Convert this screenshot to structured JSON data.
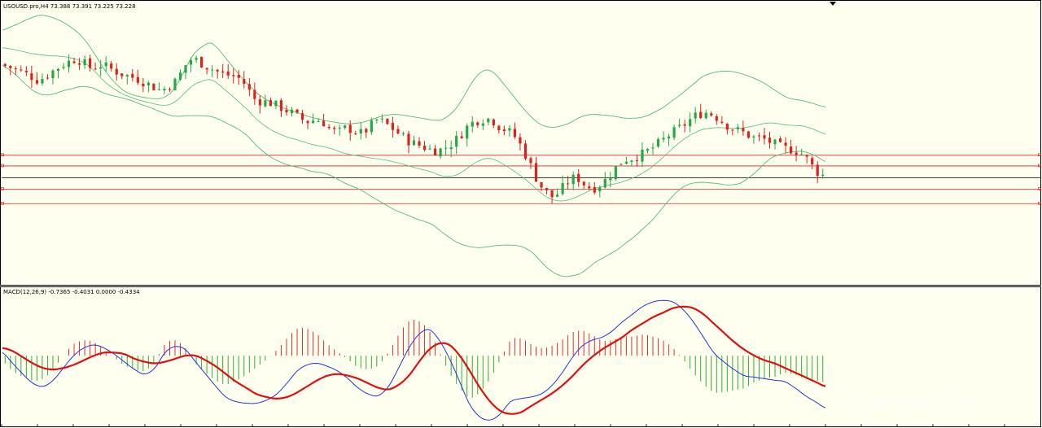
{
  "header": {
    "title": "USOUSD.pro,H4 73.388 73.391 73.225 73.228"
  },
  "indicator": {
    "title": "MACD(12,26,9) -0.7365 -0.4031 0.0000 -0.4334"
  },
  "watermark": "@WeTrade众汇 官方",
  "colors": {
    "background": "#fffff0",
    "bull": "#22aa44",
    "bear": "#e0201a",
    "bands": "#55bb77",
    "level": "#e02020",
    "macd_line": "#2233dd",
    "signal_line": "#e01010",
    "hist_pos": "#e03030",
    "hist_neg": "#33aa33"
  },
  "chart_data": [
    {
      "type": "candlestick",
      "panel": "price",
      "y_scale": "unlabeled",
      "bands_type": "bollinger",
      "close_series": [
        -3.4,
        -3.8,
        -4.2,
        -4.7,
        -5.3,
        -5.9,
        -5.2,
        -4.4,
        -3.6,
        -3.0,
        -2.6,
        -3.3,
        -4.0,
        -3.5,
        -3.9,
        -4.5,
        -5.0,
        -5.4,
        -5.8,
        -6.4,
        -7.0,
        -7.5,
        -6.8,
        -5.9,
        -3.8,
        -2.6,
        -3.1,
        -3.8,
        -4.4,
        -5.0,
        -5.2,
        -5.6,
        -6.8,
        -8.8,
        -9.3,
        -9.5,
        -10.0,
        -10.6,
        -11.2,
        -12.0,
        -12.5,
        -12.3,
        -12.6,
        -13.8,
        -14.2,
        -13.6,
        -14.0,
        -14.4,
        -13.5,
        -12.3,
        -12.8,
        -13.6,
        -14.6,
        -15.5,
        -16.1,
        -16.5,
        -17.0,
        -17.1,
        -16.6,
        -15.8,
        -14.5,
        -13.1,
        -12.4,
        -12.1,
        -12.3,
        -13.4,
        -14.0,
        -15.0,
        -17.0,
        -19.5,
        -22.1,
        -23.7,
        -24.5,
        -23.3,
        -22.0,
        -21.5,
        -22.5,
        -23.1,
        -22.6,
        -21.5,
        -20.0,
        -18.7,
        -18.4,
        -18.0,
        -17.4,
        -16.6,
        -15.7,
        -14.7,
        -13.9,
        -13.0,
        -12.0,
        -11.3,
        -11.1,
        -11.7,
        -12.6,
        -13.5,
        -14.0,
        -14.5,
        -15.1,
        -15.2,
        -15.7,
        -16.3,
        -16.8,
        -17.0,
        -17.5,
        -18.6,
        -20.2,
        -21.1
      ],
      "bollinger_upper": [
        2.0,
        2.5,
        3.0,
        3.6,
        4.1,
        4.4,
        4.2,
        3.8,
        3.2,
        2.4,
        1.4,
        0.0,
        -1.8,
        -3.8,
        -5.5,
        -6.8,
        -7.8,
        -8.3,
        -8.6,
        -8.8,
        -8.9,
        -8.7,
        -7.8,
        -6.0,
        -3.6,
        -1.6,
        -0.6,
        0.0,
        -0.9,
        -2.4,
        -3.9,
        -5.4,
        -6.7,
        -7.9,
        -8.8,
        -9.5,
        -10.1,
        -10.6,
        -11.0,
        -11.4,
        -11.8,
        -12.1,
        -12.4,
        -12.6,
        -12.8,
        -12.9,
        -12.8,
        -12.6,
        -12.2,
        -11.8,
        -11.5,
        -11.4,
        -11.5,
        -11.7,
        -11.9,
        -12.1,
        -12.3,
        -12.3,
        -11.6,
        -10.4,
        -8.5,
        -6.4,
        -4.9,
        -4.3,
        -4.9,
        -6.3,
        -7.8,
        -9.4,
        -10.8,
        -12.1,
        -13.0,
        -13.4,
        -13.4,
        -13.1,
        -12.6,
        -11.9,
        -11.5,
        -11.4,
        -11.5,
        -11.6,
        -11.8,
        -12.0,
        -12.0,
        -11.9,
        -11.5,
        -10.9,
        -10.2,
        -9.3,
        -8.4,
        -7.4,
        -6.4,
        -5.4,
        -4.9,
        -4.6,
        -4.5,
        -4.6,
        -4.9,
        -5.3,
        -5.8,
        -6.4,
        -7.2,
        -8.0,
        -8.7,
        -9.0,
        -9.2,
        -9.5,
        -9.9,
        -10.2
      ],
      "bollinger_lower": [
        -3.6,
        -4.4,
        -5.4,
        -6.6,
        -7.6,
        -8.2,
        -8.3,
        -8.0,
        -7.6,
        -7.3,
        -7.0,
        -7.0,
        -7.3,
        -7.9,
        -8.3,
        -8.6,
        -8.9,
        -9.3,
        -9.8,
        -10.2,
        -10.7,
        -11.2,
        -11.6,
        -11.7,
        -11.6,
        -11.6,
        -11.6,
        -11.7,
        -12.1,
        -12.7,
        -13.3,
        -14.0,
        -15.0,
        -16.3,
        -17.4,
        -18.3,
        -18.9,
        -19.4,
        -19.7,
        -20.0,
        -20.4,
        -20.6,
        -20.8,
        -21.3,
        -22.0,
        -22.6,
        -23.1,
        -23.7,
        -24.5,
        -25.2,
        -25.9,
        -26.6,
        -27.1,
        -27.6,
        -28.1,
        -28.5,
        -29.0,
        -30.0,
        -30.9,
        -31.7,
        -32.2,
        -32.5,
        -32.6,
        -32.5,
        -32.3,
        -32.2,
        -32.2,
        -32.3,
        -32.7,
        -33.5,
        -34.8,
        -36.0,
        -36.8,
        -37.2,
        -37.1,
        -36.8,
        -36.0,
        -35.0,
        -34.3,
        -33.6,
        -32.9,
        -31.9,
        -31.0,
        -29.9,
        -28.8,
        -27.5,
        -26.0,
        -24.6,
        -23.4,
        -22.6,
        -22.3,
        -22.2,
        -22.3,
        -22.4,
        -22.6,
        -22.6,
        -22.3,
        -21.5,
        -20.5,
        -19.3,
        -18.3,
        -17.8,
        -17.5,
        -17.3,
        -17.3,
        -17.6,
        -18.2,
        -18.9
      ],
      "horizontal_levels_red": [
        -17.9,
        -19.6,
        -23.3,
        -25.6
      ],
      "horizontal_level_current": -21.5
    },
    {
      "type": "macd",
      "panel": "indicator",
      "params": [
        12,
        26,
        9
      ],
      "values": {
        "macd": -0.7365,
        "signal": -0.4031,
        "level": 0.0,
        "histogram": -0.4334
      },
      "macd_series": [
        0.02,
        -0.05,
        -0.12,
        -0.18,
        -0.2,
        -0.16,
        -0.08,
        0.0,
        0.05,
        0.07,
        0.05,
        0.01,
        -0.04,
        -0.09,
        -0.12,
        -0.08,
        0.02,
        0.06,
        0.04,
        -0.04,
        -0.12,
        -0.2,
        -0.27,
        -0.3,
        -0.31,
        -0.31,
        -0.29,
        -0.25,
        -0.18,
        -0.1,
        -0.06,
        -0.05,
        -0.07,
        -0.1,
        -0.15,
        -0.21,
        -0.25,
        -0.26,
        -0.2,
        -0.08,
        0.05,
        0.14,
        0.17,
        0.1,
        -0.02,
        -0.17,
        -0.32,
        -0.4,
        -0.42,
        -0.38,
        -0.3,
        -0.28,
        -0.27,
        -0.25,
        -0.2,
        -0.12,
        -0.02,
        0.06,
        0.1,
        0.12,
        0.16,
        0.22,
        0.27,
        0.32,
        0.35,
        0.36,
        0.35,
        0.3,
        0.22,
        0.12,
        0.02,
        -0.04,
        -0.09,
        -0.13,
        -0.14,
        -0.15,
        -0.16,
        -0.17,
        -0.21,
        -0.26,
        -0.3,
        -0.34
      ],
      "signal_series": [
        0.05,
        0.03,
        -0.01,
        -0.05,
        -0.08,
        -0.09,
        -0.08,
        -0.06,
        -0.03,
        0.0,
        0.02,
        0.02,
        0.01,
        -0.02,
        -0.04,
        -0.05,
        -0.04,
        -0.02,
        0.0,
        0.0,
        -0.03,
        -0.07,
        -0.12,
        -0.17,
        -0.21,
        -0.25,
        -0.27,
        -0.28,
        -0.27,
        -0.24,
        -0.2,
        -0.16,
        -0.13,
        -0.12,
        -0.13,
        -0.15,
        -0.18,
        -0.21,
        -0.22,
        -0.19,
        -0.13,
        -0.04,
        0.04,
        0.08,
        0.07,
        0.0,
        -0.1,
        -0.21,
        -0.3,
        -0.36,
        -0.38,
        -0.37,
        -0.33,
        -0.29,
        -0.25,
        -0.2,
        -0.14,
        -0.07,
        -0.01,
        0.04,
        0.08,
        0.12,
        0.17,
        0.21,
        0.25,
        0.28,
        0.31,
        0.32,
        0.31,
        0.27,
        0.21,
        0.15,
        0.09,
        0.04,
        0.0,
        -0.03,
        -0.05,
        -0.08,
        -0.11,
        -0.14,
        -0.17,
        -0.2
      ]
    }
  ]
}
